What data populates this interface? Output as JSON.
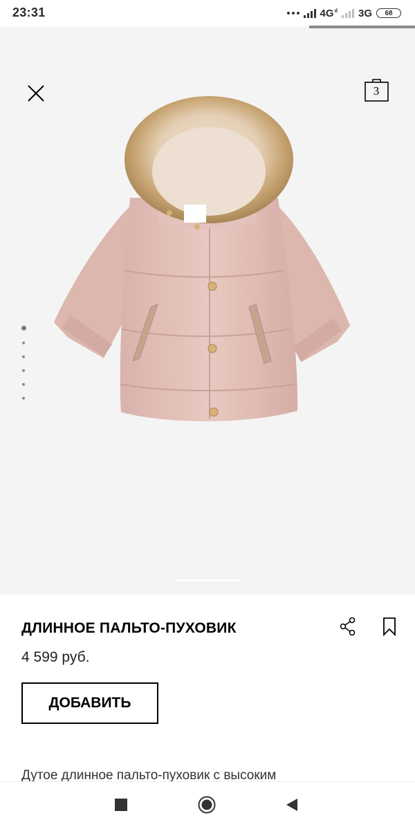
{
  "status_bar": {
    "time": "23:31",
    "network_1": "4G",
    "network_1_sup": "ıl",
    "network_2": "3G",
    "battery": "68"
  },
  "header": {
    "close_icon": "close-icon",
    "bag_icon": "shopping-bag-icon",
    "bag_count": "3"
  },
  "gallery": {
    "image_subject": "pink-puffer-coat-image",
    "page_count": 6,
    "active_page": 1
  },
  "product": {
    "title": "ДЛИННОЕ ПАЛЬТО-ПУХОВИК",
    "price": "4 599 руб.",
    "add_button_label": "ДОБАВИТЬ",
    "description": "Дутое длинное пальто-пуховик с высоким"
  },
  "icons": {
    "share": "share-icon",
    "bookmark": "bookmark-icon"
  },
  "nav_bar": {
    "recent": "square-icon",
    "home": "home-circle-icon",
    "back": "back-triangle-icon"
  },
  "colors": {
    "background": "#f4f4f4",
    "coat_pink": "#e3c2bb",
    "fur": "#c9a97a",
    "text": "#000000"
  }
}
